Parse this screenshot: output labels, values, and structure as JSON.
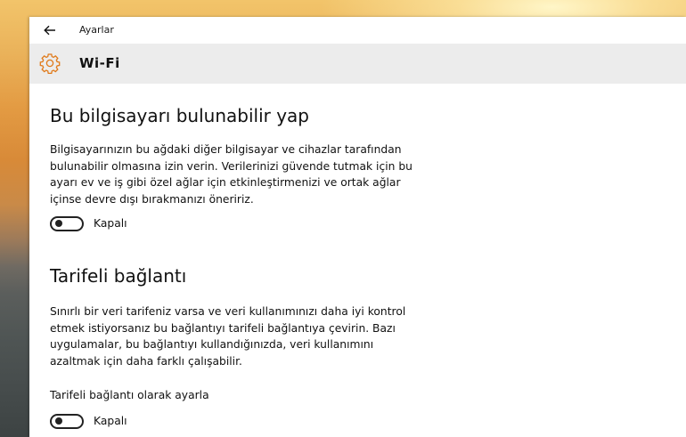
{
  "window": {
    "app_title": "Ayarlar",
    "page_title": "Wi-Fi"
  },
  "discoverable": {
    "title": "Bu bilgisayarı bulunabilir yap",
    "description_lines": [
      "Bilgisayarınızın bu ağdaki diğer bilgisayar ve cihazlar tarafından",
      "bulunabilir olmasına izin verin. Verilerinizi güvende tutmak için bu",
      "ayarı ev ve iş gibi özel ağlar için etkinleştirmenizi ve ortak ağlar",
      "içinse devre dışı bırakmanızı öneririz."
    ],
    "toggle_state": "Kapalı",
    "toggle_on": false
  },
  "metered": {
    "title": "Tarifeli bağlantı",
    "description_lines": [
      "Sınırlı bir veri tarifeniz varsa ve veri kullanımınızı daha iyi kontrol",
      "etmek istiyorsanız bu bağlantıyı tarifeli bağlantıya çevirin. Bazı",
      "uygulamalar, bu bağlantıyı kullandığınızda, veri kullanımını",
      "azaltmak için daha farklı çalışabilir."
    ],
    "field_label": "Tarifeli bağlantı olarak ayarla",
    "toggle_state": "Kapalı",
    "toggle_on": false
  },
  "icons": {
    "back": "arrow-left-icon",
    "settings": "gear-icon"
  },
  "colors": {
    "header_bg": "#ececec",
    "toggle_off": "#222222"
  }
}
